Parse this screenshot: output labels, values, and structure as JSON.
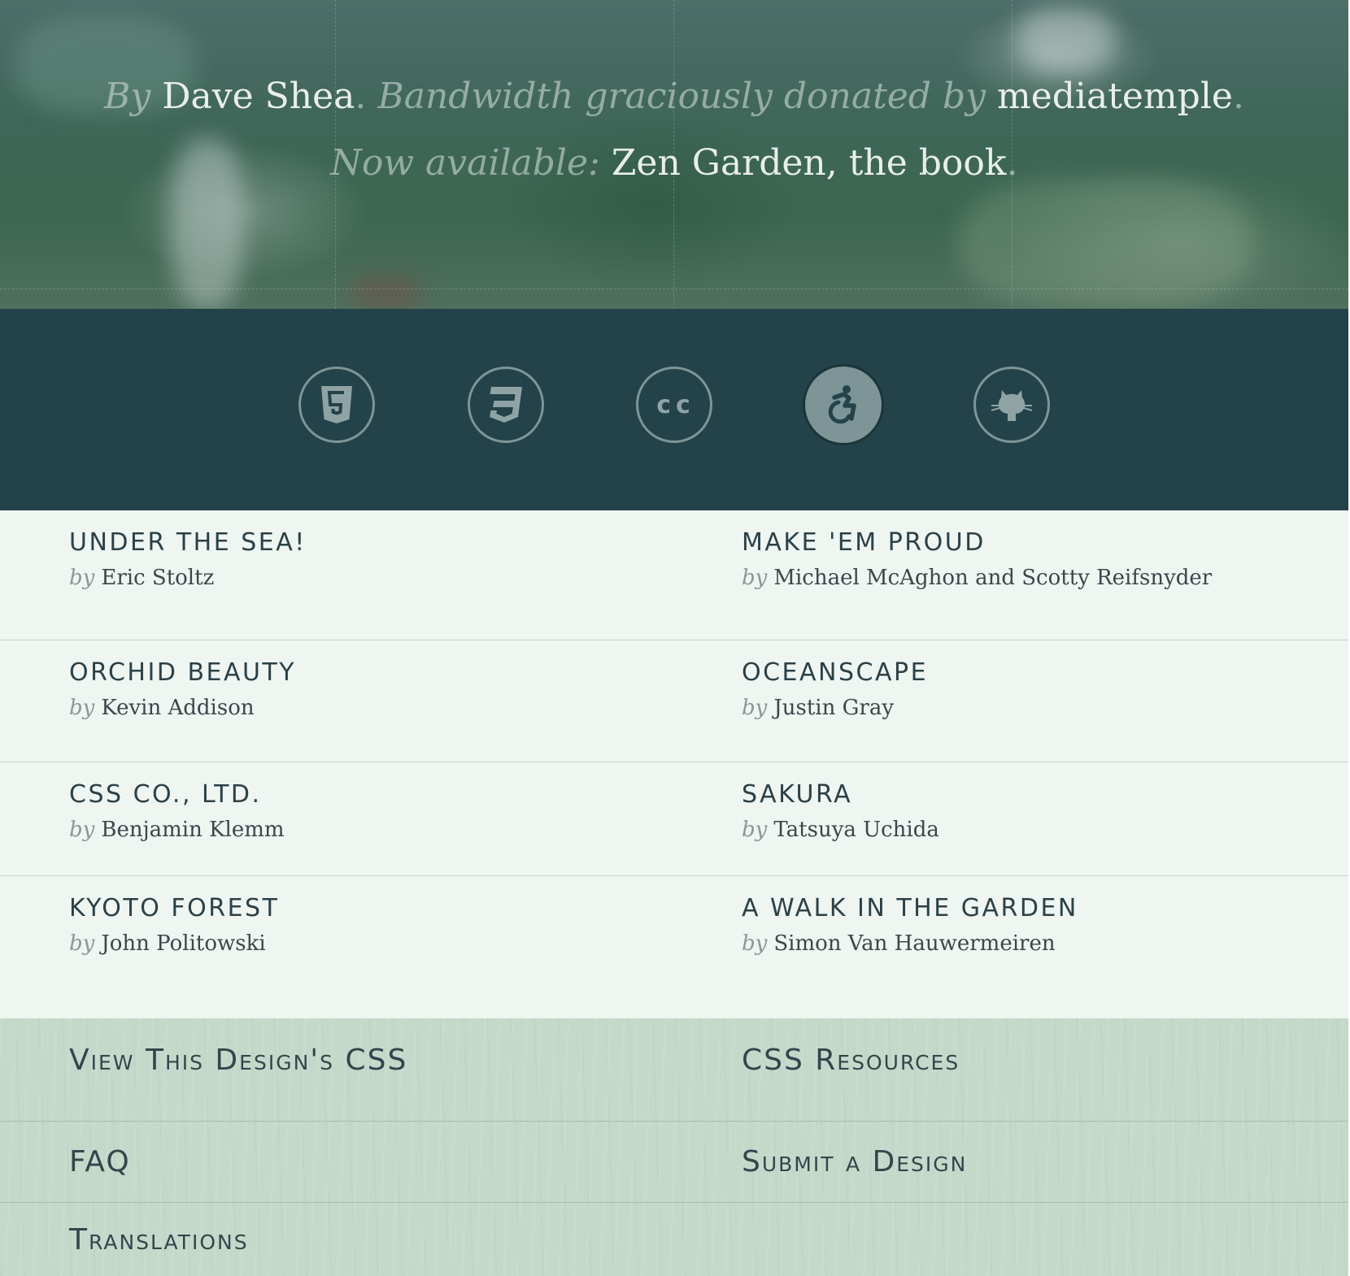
{
  "credits": {
    "by": "By",
    "author": "Dave Shea",
    "period1": ".",
    "bandwidth": "Bandwidth graciously donated by",
    "sponsor": "mediatemple",
    "period2": ".",
    "now_available": "Now available:",
    "book": "Zen Garden, the book",
    "period3": "."
  },
  "icon_bar": {
    "items": [
      {
        "icon": "html5-icon",
        "label": ""
      },
      {
        "icon": "css3-icon",
        "label": ""
      },
      {
        "icon": "creative-commons-icon",
        "label": "cc"
      },
      {
        "icon": "accessibility-icon",
        "label": "",
        "active": true
      },
      {
        "icon": "github-octocat-icon",
        "label": ""
      }
    ],
    "colors": {
      "background": "#234249",
      "icon": "#7e9597"
    }
  },
  "designs": [
    {
      "title": "Under the Sea!",
      "by": "by",
      "author": "Eric Stoltz"
    },
    {
      "title": "Make 'em Proud",
      "by": "by",
      "author": "Michael McAghon and Scotty Reifsnyder"
    },
    {
      "title": "Orchid Beauty",
      "by": "by",
      "author": "Kevin Addison"
    },
    {
      "title": "Oceanscape",
      "by": "by",
      "author": "Justin Gray"
    },
    {
      "title": "CSS Co., Ltd.",
      "by": "by",
      "author": "Benjamin Klemm"
    },
    {
      "title": "Sakura",
      "by": "by",
      "author": "Tatsuya Uchida"
    },
    {
      "title": "Kyoto Forest",
      "by": "by",
      "author": "John Politowski"
    },
    {
      "title": "A Walk in the Garden",
      "by": "by",
      "author": "Simon Van Hauwermeiren"
    }
  ],
  "resources": {
    "view_css": "View This Design's CSS",
    "css_resources": "CSS Resources",
    "faq": "FAQ",
    "submit": "Submit a Design",
    "translations": "Translations"
  },
  "colors": {
    "designs_background": "#eff5f1",
    "resources_background": "#c5d9cb",
    "text_dark": "#2b4148"
  }
}
